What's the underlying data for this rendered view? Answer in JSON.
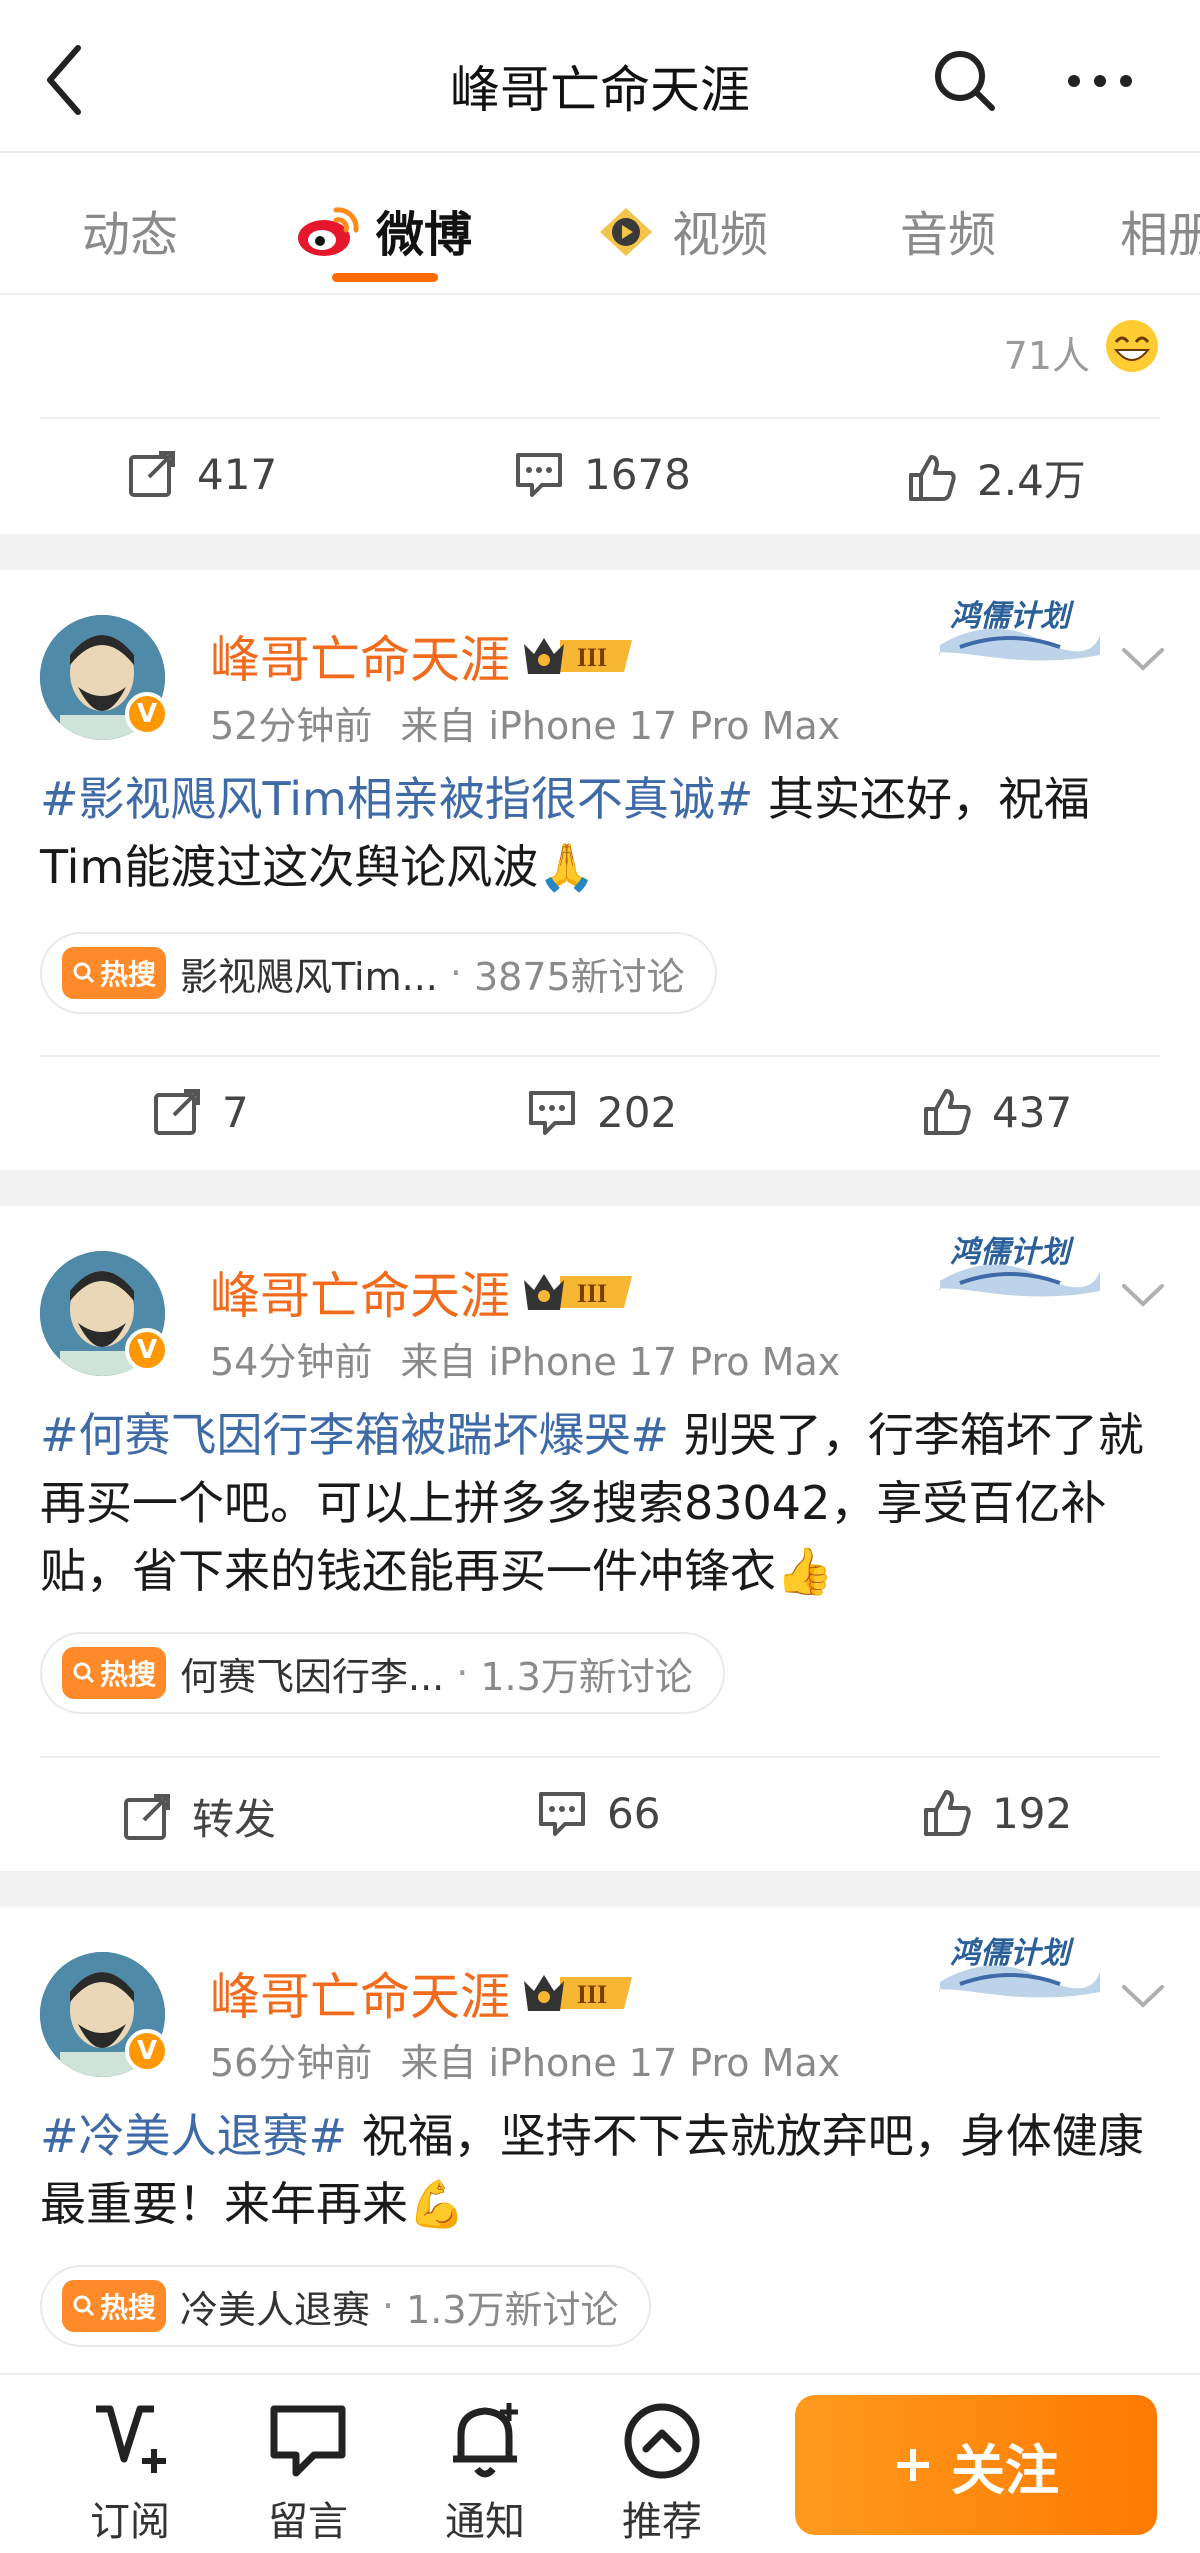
{
  "header": {
    "title": "峰哥亡命天涯"
  },
  "tabs": [
    {
      "label": "动态"
    },
    {
      "label": "微博"
    },
    {
      "label": "视频"
    },
    {
      "label": "音频"
    },
    {
      "label": "相册"
    }
  ],
  "top_post": {
    "reaction_count": "71人",
    "actions": {
      "repost": "417",
      "comment": "1678",
      "like": "2.4万"
    }
  },
  "posts": [
    {
      "author": "峰哥亡命天涯",
      "badge_level": "III",
      "plan_badge": "鸿儒计划",
      "time": "52分钟前",
      "source": "来自 iPhone 17 Pro Max",
      "topic": "#影视飓风Tim相亲被指很不真诚#",
      "text": " 其实还好，祝福Tim能渡过这次舆论风波🙏",
      "hot": {
        "tag": "热搜",
        "name": "影视飓风Tim...",
        "count": "3875新讨论"
      },
      "actions": {
        "repost": "7",
        "comment": "202",
        "like": "437"
      }
    },
    {
      "author": "峰哥亡命天涯",
      "badge_level": "III",
      "plan_badge": "鸿儒计划",
      "time": "54分钟前",
      "source": "来自 iPhone 17 Pro Max",
      "topic": "#何赛飞因行李箱被踹坏爆哭#",
      "text": " 别哭了，行李箱坏了就再买一个吧。可以上拼多多搜索83042，享受百亿补贴，省下来的钱还能再买一件冲锋衣👍",
      "hot": {
        "tag": "热搜",
        "name": "何赛飞因行李...",
        "count": "1.3万新讨论"
      },
      "actions": {
        "repost": "转发",
        "comment": "66",
        "like": "192"
      }
    },
    {
      "author": "峰哥亡命天涯",
      "badge_level": "III",
      "plan_badge": "鸿儒计划",
      "time": "56分钟前",
      "source": "来自 iPhone 17 Pro Max",
      "topic": "#冷美人退赛#",
      "text": " 祝福，坚持不下去就放弃吧，身体健康最重要！来年再来💪",
      "hot": {
        "tag": "热搜",
        "name": "冷美人退赛",
        "count": "1.3万新讨论"
      }
    }
  ],
  "bottom_nav": [
    {
      "label": "订阅"
    },
    {
      "label": "留言"
    },
    {
      "label": "通知"
    },
    {
      "label": "推荐"
    }
  ],
  "follow": {
    "label": "关注"
  },
  "colors": {
    "accent": "#ff7a00",
    "author": "#f26b1d",
    "topic": "#3f6aa8"
  }
}
